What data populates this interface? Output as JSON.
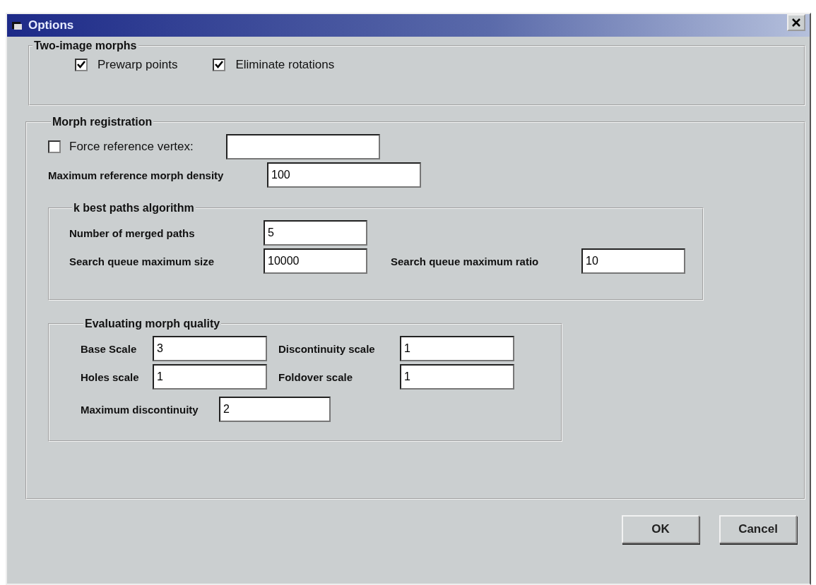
{
  "window": {
    "title": "Options"
  },
  "two_image_morphs": {
    "legend": "Two-image morphs",
    "checkboxes": [
      {
        "label": "Prewarp points",
        "checked": true
      },
      {
        "label": "Eliminate rotations",
        "checked": true
      }
    ]
  },
  "morph_registration": {
    "legend": "Morph registration",
    "force_reference_vertex": {
      "label": "Force reference vertex:",
      "checked": false
    },
    "density": {
      "label": "Maximum reference morph density",
      "value": "100"
    },
    "k_best_paths": {
      "legend": "k best paths algorithm",
      "fields": [
        {
          "label": "Number of merged paths",
          "value": "5"
        },
        {
          "label": "Search queue maximum size",
          "value": "10000"
        },
        {
          "label": "Search queue maximum ratio",
          "value": "10"
        }
      ]
    },
    "evaluating_quality": {
      "legend": "Evaluating morph quality",
      "fields": [
        {
          "label": "Base Scale",
          "value": "3"
        },
        {
          "label": "Discontinuity scale",
          "value": "1"
        },
        {
          "label": "Holes scale",
          "value": "1"
        },
        {
          "label": "Foldover scale",
          "value": "1"
        },
        {
          "label": "Maximum discontinuity",
          "value": "2"
        }
      ]
    }
  },
  "buttons": [
    "OK",
    "Cancel"
  ]
}
